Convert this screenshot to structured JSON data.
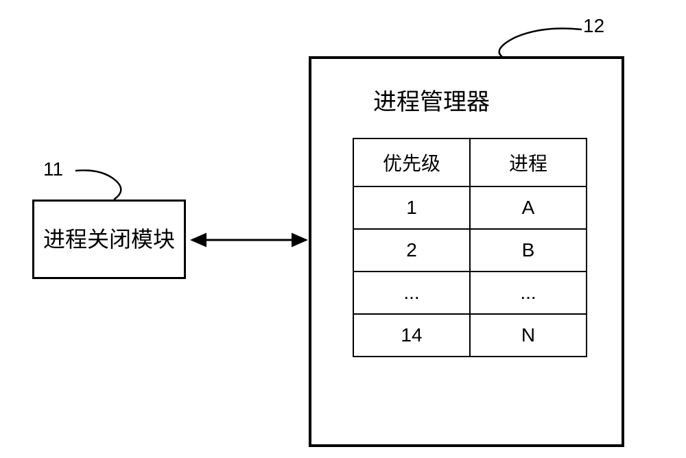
{
  "labels": {
    "left": "11",
    "right": "12"
  },
  "leftBox": {
    "title": "进程关闭模块"
  },
  "rightBox": {
    "title": "进程管理器",
    "tableHeaders": {
      "priority": "优先级",
      "process": "进程"
    },
    "rows": [
      {
        "priority": "1",
        "process": "A"
      },
      {
        "priority": "2",
        "process": "B"
      },
      {
        "priority": "...",
        "process": "..."
      },
      {
        "priority": "14",
        "process": "N"
      }
    ]
  }
}
